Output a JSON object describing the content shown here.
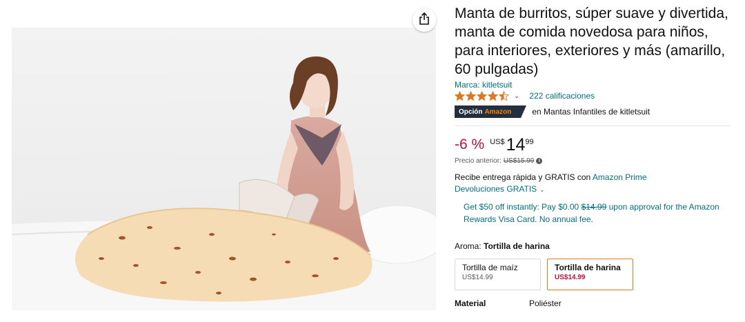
{
  "product": {
    "title": "Manta de burritos, súper suave y divertida, manta de comida novedosa para niños, para interiores, exteriores y más (amarillo, 60 pulgadas)",
    "brand": "Marca: kitletsuit",
    "rating_value": 4.5,
    "ratings_count": "222 calificaciones",
    "choice_badge": {
      "label": "Opción",
      "brand": "Amazon"
    },
    "choice_text": "en Mantas Infantiles de kitletsuit"
  },
  "price": {
    "discount": "-6 %",
    "currency": "US$",
    "whole": "14",
    "fraction": "99",
    "previous_label": "Precio anterior:",
    "previous_value": "US$15.99"
  },
  "delivery": {
    "text": "Recibe entrega rápida y GRATIS con ",
    "link": "Amazon Prime",
    "returns": "Devoluciones GRATIS"
  },
  "promo": {
    "before": "Get $50 off instantly: Pay $0.00 ",
    "struck": "$14.99",
    "after": " upon approval for the Amazon Rewards Visa Card. No annual fee."
  },
  "aroma": {
    "label": "Aroma:",
    "selected": "Tortilla de harina",
    "options": [
      {
        "name": "Tortilla de maíz",
        "price": "US$14.99"
      },
      {
        "name": "Tortilla de harina",
        "price": "US$14.99"
      }
    ]
  },
  "specs": [
    {
      "key": "Material",
      "value": "Poliéster"
    }
  ],
  "colors": {
    "link": "#007185",
    "discount": "#cc0c39",
    "star": "#de7921",
    "badge_bg": "#232f3e",
    "badge_accent": "#f08804",
    "selected_border": "#e47911"
  },
  "icons": {
    "share": "share-icon",
    "info": "info-icon",
    "chevron": "chevron-down-icon"
  }
}
